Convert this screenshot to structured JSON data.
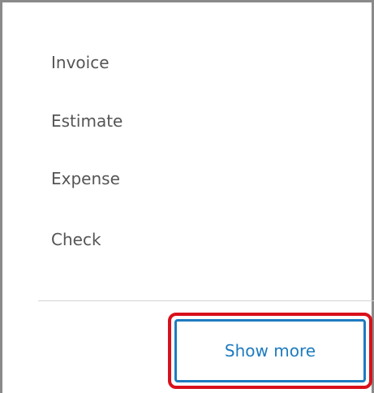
{
  "menu": {
    "items": [
      {
        "label": "Invoice"
      },
      {
        "label": "Estimate"
      },
      {
        "label": "Expense"
      },
      {
        "label": "Check"
      }
    ]
  },
  "footer": {
    "show_more_label": "Show more"
  },
  "colors": {
    "border": "#8a8a8a",
    "item_text": "#555555",
    "divider": "#d4d4d4",
    "button_accent": "#1e7bbf",
    "highlight": "#d9101b"
  }
}
